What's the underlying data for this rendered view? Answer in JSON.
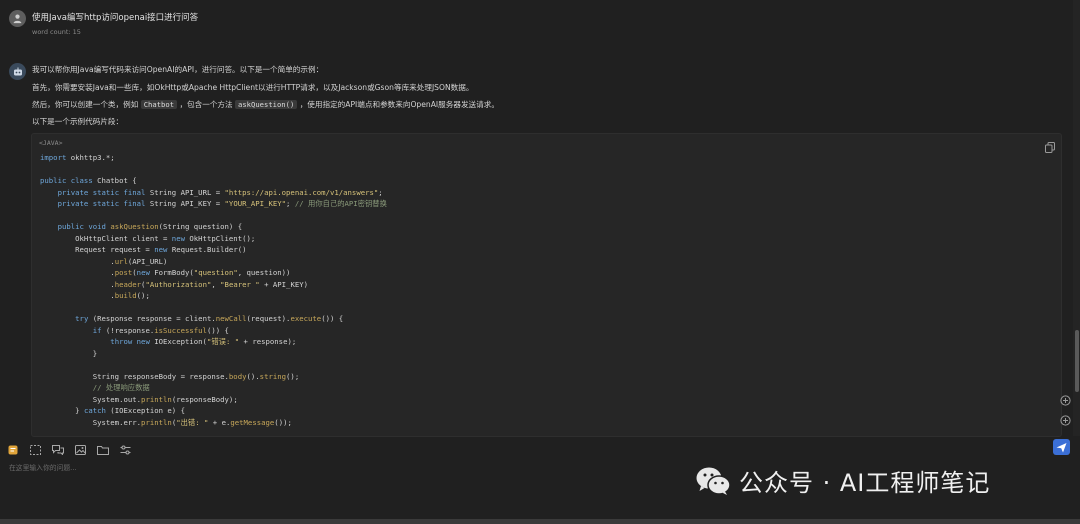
{
  "question": {
    "text": "使用Java编写http访问openai接口进行问答",
    "word_count": "word count: 15"
  },
  "answer": {
    "p1": "我可以帮你用Java编写代码来访问OpenAI的API，进行问答。以下是一个简单的示例：",
    "p2": "首先，你需要安装Java和一些库，如OkHttp或Apache HttpClient以进行HTTP请求，以及Jackson或Gson等库来处理JSON数据。",
    "p3_a": "然后，你可以创建一个类，例如",
    "p3_code1": "Chatbot",
    "p3_b": "，包含一个方法",
    "p3_code2": "askQuestion()",
    "p3_c": "，使用指定的API端点和参数来向OpenAI服务器发送请求。",
    "p4": "以下是一个示例代码片段："
  },
  "code_block": {
    "language": "<JAVA>"
  },
  "input": {
    "placeholder": "在这里输入你的问题..."
  },
  "watermark": {
    "text": "公众号 · AI工程师笔记"
  },
  "colors": {
    "background": "#202020",
    "code_bg": "#262626",
    "send_button": "#3b6fd6",
    "keyword": "#6fa8dc",
    "string": "#d6c27a"
  }
}
